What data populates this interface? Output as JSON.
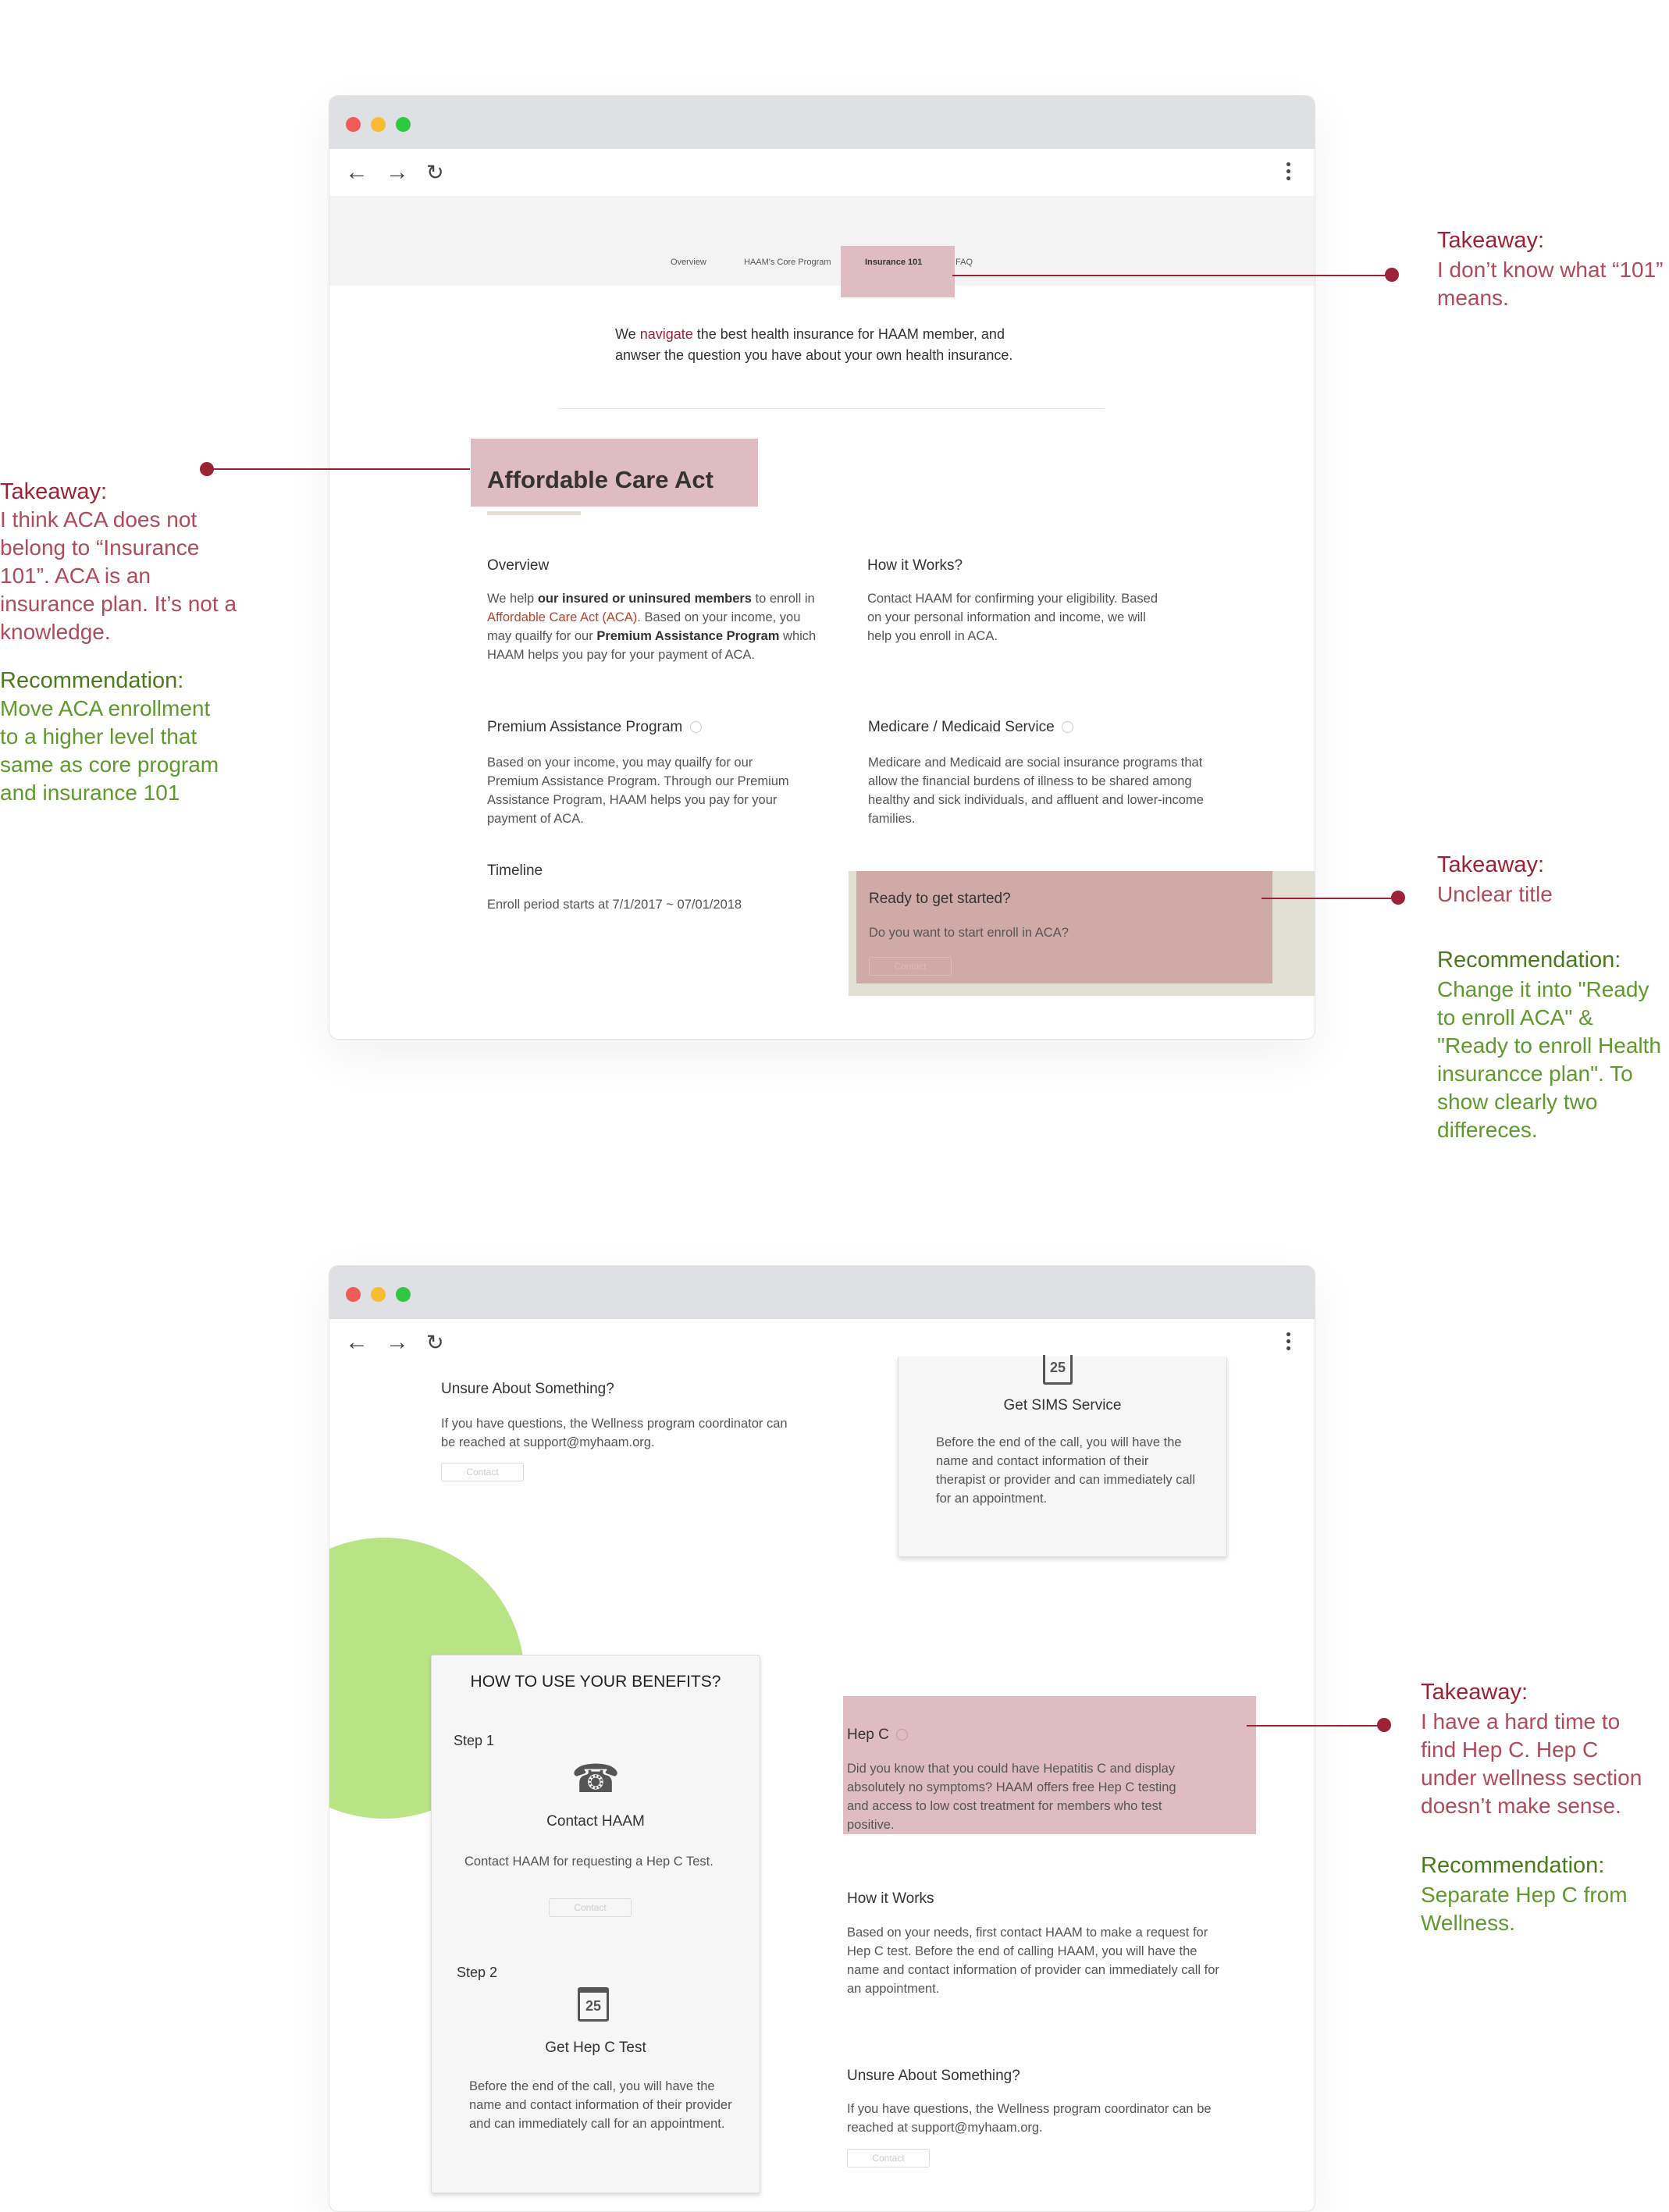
{
  "window1": {
    "nav": {
      "overview": "Overview",
      "core_program": "HAAM's Core Program",
      "insurance101": "Insurance 101",
      "faq": "FAQ"
    },
    "intro": {
      "pre": "We ",
      "highlight": "navigate",
      "post": " the best health insurance for HAAM member, and anwser the question you have about your own health insurance."
    },
    "section_title": "Affordable Care Act",
    "overview": {
      "title": "Overview",
      "t1": "We help ",
      "b1": "our insured or uninsured members",
      "t2": " to enroll in ",
      "link": "Affordable Care Act (ACA)",
      "t3": ". Based on your income, you may quailfy for our ",
      "b2": "Premium Assistance Program",
      "t4": " which HAAM helps you pay for your payment of ACA."
    },
    "how_it_works": {
      "title": "How it Works?",
      "text": "Contact HAAM for confirming your eligibility. Based on your personal information and income, we will help you enroll in ACA."
    },
    "premium": {
      "title": "Premium Assistance Program",
      "text": "Based on your income, you may quailfy for our Premium Assistance Program. Through our Premium Assistance Program, HAAM helps you pay for your payment of ACA."
    },
    "medicare": {
      "title": "Medicare / Medicaid Service",
      "text": "Medicare and Medicaid are social insurance programs that allow the financial burdens of illness to be shared among healthy and sick individuals, and affluent and lower-income families."
    },
    "timeline": {
      "title": "Timeline",
      "text": "Enroll period starts at 7/1/2017 ~ 07/01/2018"
    },
    "cta": {
      "title": "Ready to get started?",
      "text": "Do you want to start enroll in ACA?",
      "button": "Contact"
    }
  },
  "window2": {
    "unsure_top": {
      "title": "Unsure About Something?",
      "text": "If you have questions, the Wellness program coordinator can be reached at support@myhaam.org.",
      "button": "Contact"
    },
    "sims_card": {
      "calendar_day": "25",
      "title": "Get SIMS Service",
      "text": "Before the end of the call, you will have the name and contact information of their therapist or provider and can immediately call for an appointment."
    },
    "benefits": {
      "title": "HOW TO USE YOUR BENEFITS?",
      "step1": {
        "label": "Step 1",
        "title": "Contact HAAM",
        "text": "Contact HAAM for requesting a Hep C Test.",
        "button": "Contact"
      },
      "step2": {
        "label": "Step 2",
        "calendar_day": "25",
        "title": "Get Hep C Test",
        "text": "Before the end of the call, you will have the name and contact information of their provider and can immediately call for an appointment."
      }
    },
    "hepc": {
      "title": "Hep C",
      "text": "Did you know that you could have Hepatitis C and display absolutely no symptoms? HAAM offers free Hep C testing and access to low cost treatment for members who test positive."
    },
    "how_it_works": {
      "title": "How it Works",
      "text": "Based on your needs, first contact HAAM to make a request for Hep C test. Before the end of calling HAAM, you will have the name and contact information of provider can immediately call for an appointment."
    },
    "unsure_bottom": {
      "title": "Unsure About Something?",
      "text": "If you have questions, the Wellness program coordinator can be reached at support@myhaam.org.",
      "button": "Contact"
    }
  },
  "annotations": {
    "a1": {
      "takeaway_label": "Takeaway:",
      "takeaway": "I don’t know what “101” means."
    },
    "a2": {
      "takeaway_label": "Takeaway:",
      "takeaway": "I think ACA does not belong to “Insurance 101”. ACA is an insurance plan. It’s not a knowledge.",
      "recommendation_label": "Recommendation:",
      "recommendation": "Move ACA enrollment to a higher level that same as core program and insurance 101"
    },
    "a3": {
      "takeaway_label": "Takeaway:",
      "takeaway": "Unclear title",
      "recommendation_label": "Recommendation:",
      "recommendation": "Change it into \"Ready to enroll ACA\" & \"Ready to enroll Health insurancce plan\". To show clearly two differeces."
    },
    "a4": {
      "takeaway_label": "Takeaway:",
      "takeaway": "I have a hard time to find Hep C. Hep C under wellness section doesn’t make sense.",
      "recommendation_label": "Recommendation:",
      "recommendation": "Separate Hep C from Wellness."
    }
  },
  "colors": {
    "takeaway": "#9b2335",
    "recommendation": "#4b7a1c",
    "highlight_box": "#dfbcc2",
    "green_circle": "#b8e486"
  }
}
